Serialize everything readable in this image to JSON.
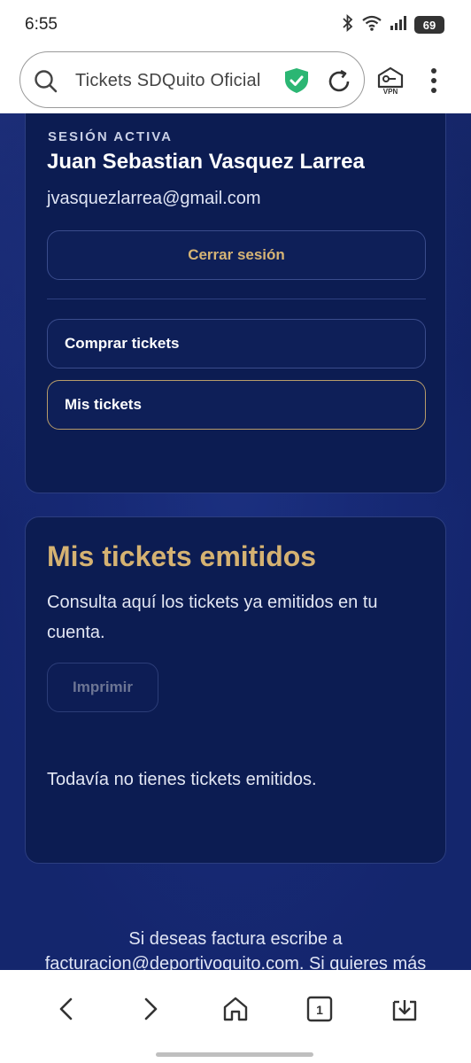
{
  "status_bar": {
    "time": "6:55",
    "battery": "69"
  },
  "browser": {
    "url_text": "Tickets SDQuito Oficial",
    "vpn_label": "VPN"
  },
  "session": {
    "eyebrow": "SESIÓN ACTIVA",
    "user_name": "Juan Sebastian Vasquez Larrea",
    "email": "jvasquezlarrea@gmail.com",
    "logout_label": "Cerrar sesión",
    "buy_label": "Comprar tickets",
    "my_tickets_label": "Mis tickets"
  },
  "issued": {
    "title": "Mis tickets emitidos",
    "description": "Consulta aquí los tickets ya emitidos en tu cuenta.",
    "print_label": "Imprimir",
    "empty_message": "Todavía no tienes tickets emitidos."
  },
  "footer": {
    "line1": "Si deseas factura escribe a",
    "line2": "facturacion@deportivoquito.com. Si quieres más"
  },
  "bottom_nav": {
    "tabs_count": "1"
  },
  "colors": {
    "accent_gold": "#d5b272",
    "navy_bg": "#13256a",
    "card_bg": "#0c1c52",
    "shield_green": "#2bb673"
  }
}
